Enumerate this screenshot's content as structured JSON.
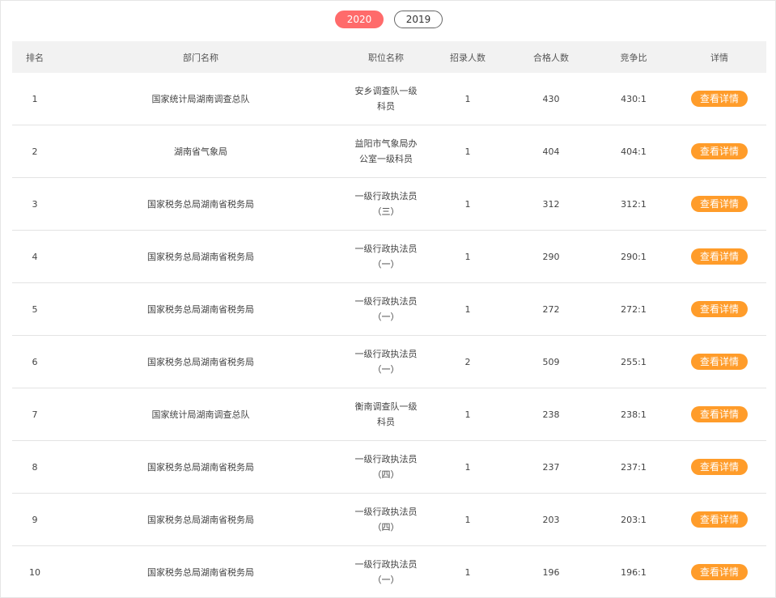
{
  "tabs": [
    {
      "label": "2020",
      "active": true
    },
    {
      "label": "2019",
      "active": false
    }
  ],
  "colors": {
    "active_tab": "#ff6b6b",
    "button": "#ff9c2a",
    "header_bg": "#f2f2f2"
  },
  "table": {
    "headers": [
      "排名",
      "部门名称",
      "职位名称",
      "招录人数",
      "合格人数",
      "竞争比",
      "详情"
    ],
    "detail_button_label": "查看详情",
    "rows": [
      {
        "rank": "1",
        "dept": "国家统计局湖南调查总队",
        "pos": "安乡调查队一级科员",
        "recruit": "1",
        "qualified": "430",
        "ratio": "430:1"
      },
      {
        "rank": "2",
        "dept": "湖南省气象局",
        "pos": "益阳市气象局办公室一级科员",
        "recruit": "1",
        "qualified": "404",
        "ratio": "404:1"
      },
      {
        "rank": "3",
        "dept": "国家税务总局湖南省税务局",
        "pos": "一级行政执法员（三）",
        "recruit": "1",
        "qualified": "312",
        "ratio": "312:1"
      },
      {
        "rank": "4",
        "dept": "国家税务总局湖南省税务局",
        "pos": "一级行政执法员（一）",
        "recruit": "1",
        "qualified": "290",
        "ratio": "290:1"
      },
      {
        "rank": "5",
        "dept": "国家税务总局湖南省税务局",
        "pos": "一级行政执法员（一）",
        "recruit": "1",
        "qualified": "272",
        "ratio": "272:1"
      },
      {
        "rank": "6",
        "dept": "国家税务总局湖南省税务局",
        "pos": "一级行政执法员（一）",
        "recruit": "2",
        "qualified": "509",
        "ratio": "255:1"
      },
      {
        "rank": "7",
        "dept": "国家统计局湖南调查总队",
        "pos": "衡南调查队一级科员",
        "recruit": "1",
        "qualified": "238",
        "ratio": "238:1"
      },
      {
        "rank": "8",
        "dept": "国家税务总局湖南省税务局",
        "pos": "一级行政执法员（四）",
        "recruit": "1",
        "qualified": "237",
        "ratio": "237:1"
      },
      {
        "rank": "9",
        "dept": "国家税务总局湖南省税务局",
        "pos": "一级行政执法员（四）",
        "recruit": "1",
        "qualified": "203",
        "ratio": "203:1"
      },
      {
        "rank": "10",
        "dept": "国家税务总局湖南省税务局",
        "pos": "一级行政执法员（一）",
        "recruit": "1",
        "qualified": "196",
        "ratio": "196:1"
      }
    ]
  }
}
